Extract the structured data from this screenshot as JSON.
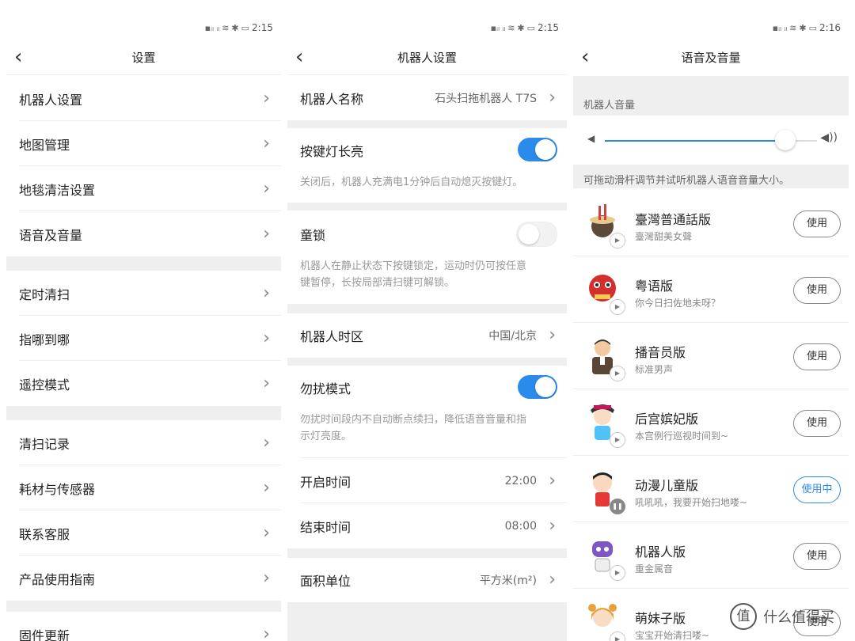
{
  "status_bar": [
    {
      "time": "2:15",
      "battery": "71"
    },
    {
      "time": "2:15",
      "battery": "71"
    },
    {
      "time": "2:16",
      "battery": "72"
    }
  ],
  "colors": {
    "accent": "#2a8bea",
    "section_bg": "#efefef",
    "text": "#222222",
    "muted": "#999999"
  },
  "panel1": {
    "title": "设置",
    "items": [
      "机器人设置",
      "地图管理",
      "地毯清洁设置",
      "语音及音量",
      "定时清扫",
      "指哪到哪",
      "遥控模式",
      "清扫记录",
      "耗材与传感器",
      "联系客服",
      "产品使用指南",
      "固件更新"
    ]
  },
  "panel2": {
    "title": "机器人设置",
    "name_label": "机器人名称",
    "name_value": "石头扫拖机器人 T7S",
    "key_light_label": "按键灯长亮",
    "key_light_on": true,
    "key_light_desc": "关闭后，机器人充满电1分钟后自动熄灭按键灯。",
    "child_lock_label": "童锁",
    "child_lock_on": false,
    "child_lock_desc_1": "机器人在静止状态下按键锁定，运动时仍可按任意",
    "child_lock_desc_2": "键暂停，长按局部清扫键可解锁。",
    "timezone_label": "机器人时区",
    "timezone_value": "中国/北京",
    "dnd_label": "勿扰模式",
    "dnd_on": true,
    "dnd_desc_1": "勿扰时间段内不自动断点续扫，降低语音音量和指",
    "dnd_desc_2": "示灯亮度。",
    "start_label": "开启时间",
    "start_value": "22:00",
    "end_label": "结束时间",
    "end_value": "08:00",
    "area_label": "面积单位",
    "area_value": "平方米(m²)"
  },
  "panel3": {
    "title": "语音及音量",
    "volume_label": "机器人音量",
    "volume_level": 0.85,
    "slider_tip": "可拖动滑杆调节并试听机器人语音音量大小。",
    "use_label": "使用",
    "in_use_label": "使用中",
    "voices": [
      {
        "name": "臺灣普通話版",
        "sub": "臺灣甜美女聲",
        "icon": "noodle-bowl-icon",
        "active": false
      },
      {
        "name": "粤语版",
        "sub": "你今日扫佐地未呀？",
        "icon": "lion-dance-icon",
        "active": false
      },
      {
        "name": "播音员版",
        "sub": "标准男声",
        "icon": "announcer-icon",
        "active": false
      },
      {
        "name": "后宫嫔妃版",
        "sub": "本宫例行巡视时间到~",
        "icon": "concubine-icon",
        "active": false
      },
      {
        "name": "动漫儿童版",
        "sub": "吼吼吼，我要开始扫地喽~",
        "icon": "cartoon-boy-icon",
        "active": true
      },
      {
        "name": "机器人版",
        "sub": "重金属音",
        "icon": "robot-icon",
        "active": false
      },
      {
        "name": "萌妹子版",
        "sub": "宝宝开始清扫喽~",
        "icon": "cute-girl-icon",
        "active": false
      }
    ]
  },
  "watermark": "值 什么值得买"
}
